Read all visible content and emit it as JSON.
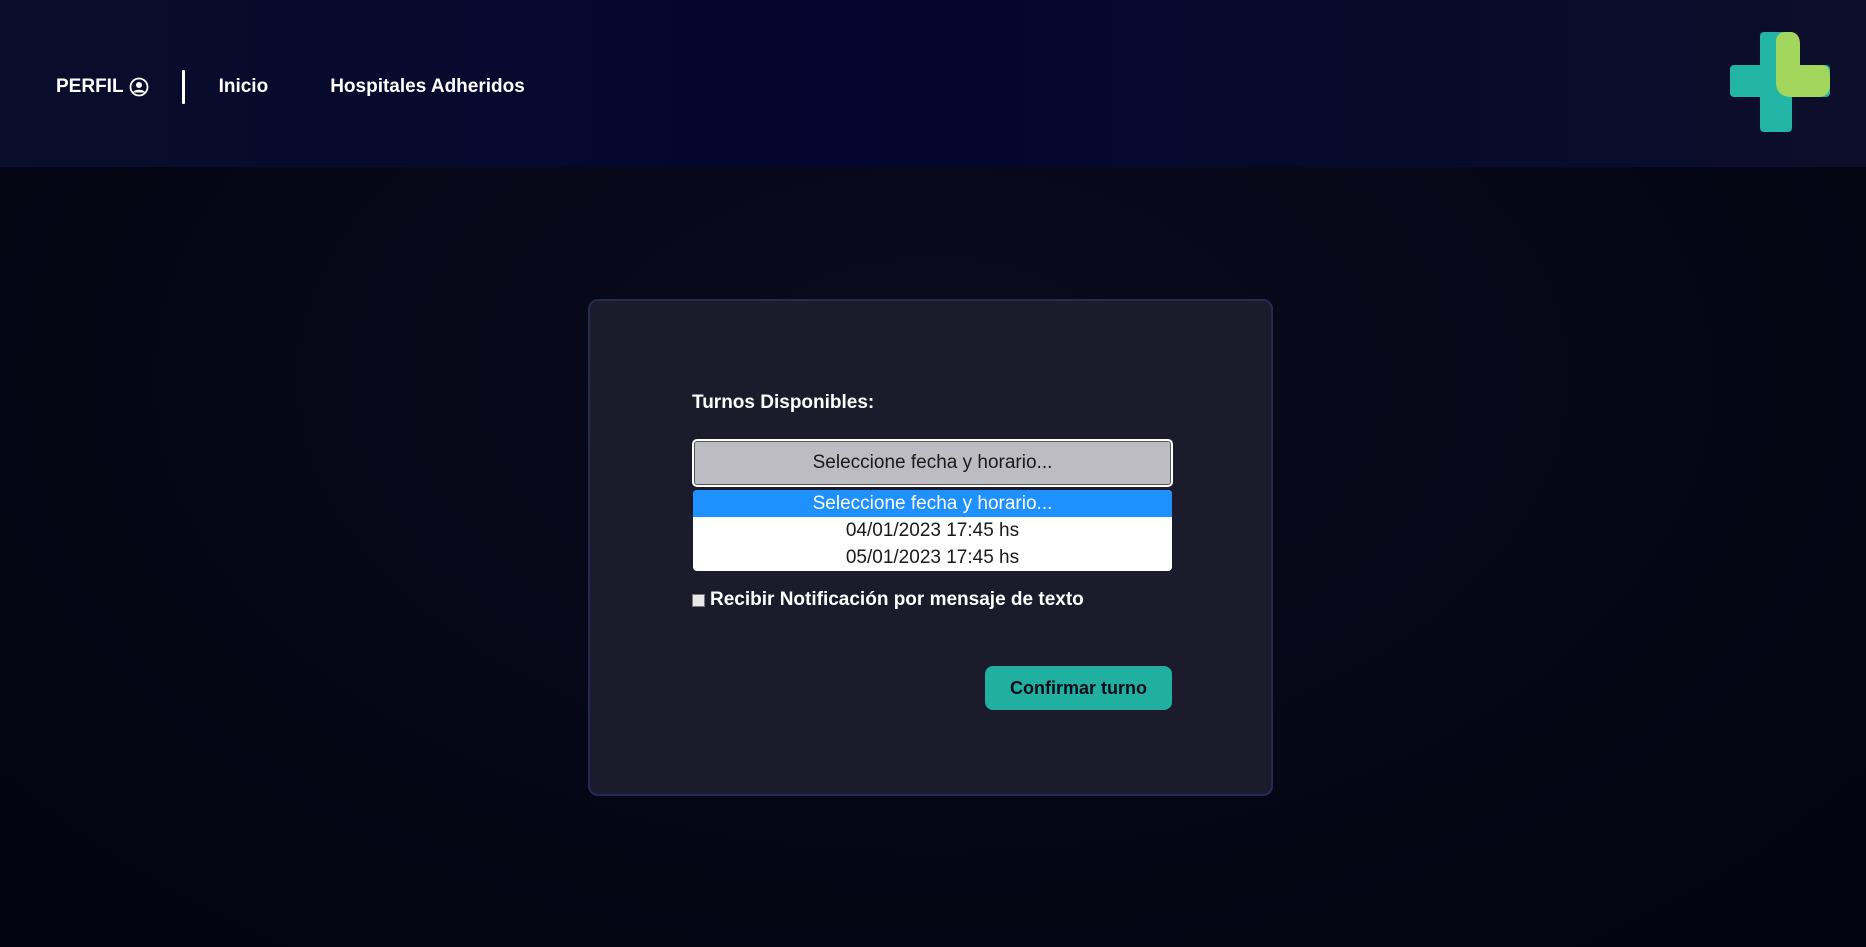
{
  "header": {
    "profile_label": "PERFIL",
    "profile_icon": "user-circle-icon",
    "nav": [
      {
        "label": "Inicio"
      },
      {
        "label": "Hospitales Adheridos"
      }
    ],
    "logo_icon": "medical-cross-logo",
    "logo_colors": {
      "teal": "#22b5a5",
      "green": "#a3d65c"
    }
  },
  "form": {
    "label": "Turnos Disponibles:",
    "select_value": "Seleccione fecha y horario...",
    "options": [
      "Seleccione fecha y horario...",
      "04/01/2023 17:45 hs",
      "05/01/2023 17:45 hs"
    ],
    "checkbox_label": "Recibir Notificación por mensaje de texto",
    "checkbox_checked": false,
    "confirm_label": "Confirmar turno"
  },
  "colors": {
    "accent": "#21b0a0",
    "selected_option": "#1e90ff",
    "card_bg": "#1b1b2b"
  }
}
